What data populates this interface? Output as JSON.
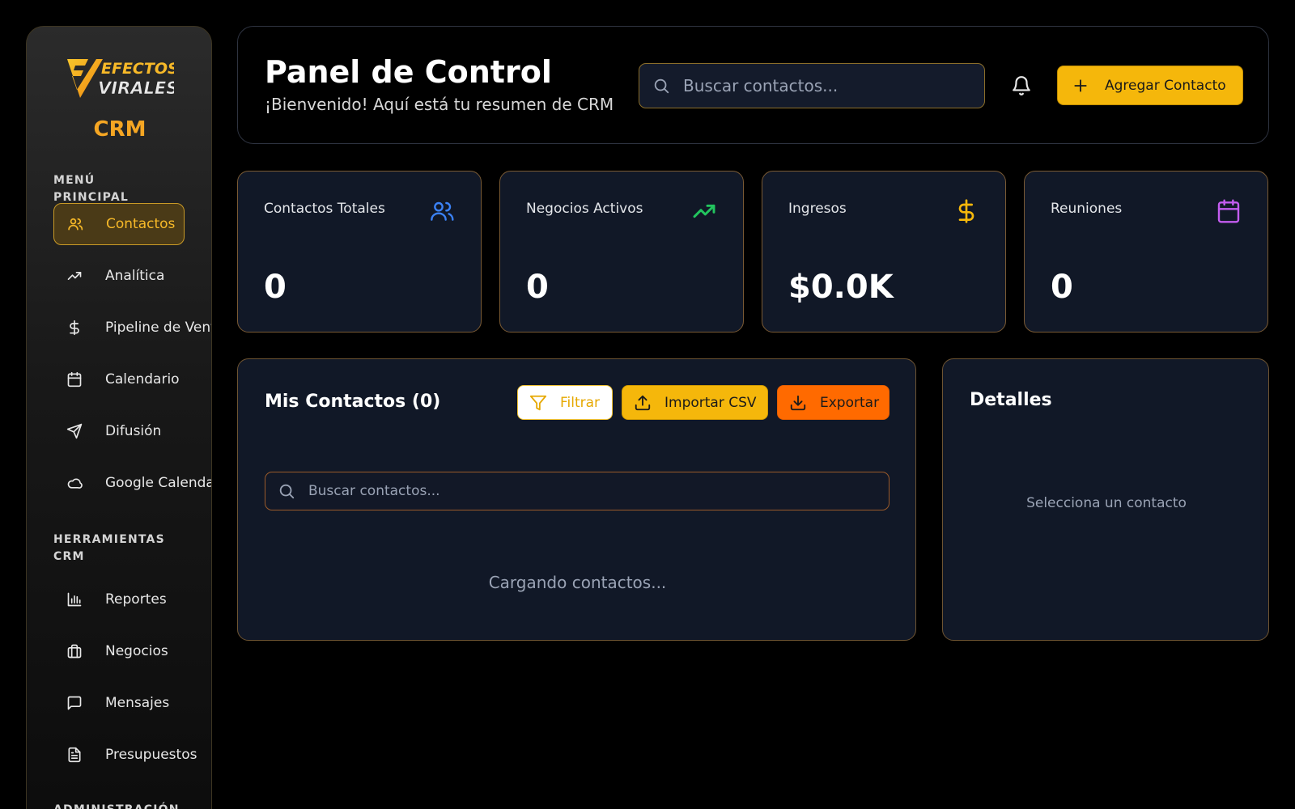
{
  "brand": {
    "logo_text_line1": "EFECTOS",
    "logo_text_line2": "VIRALES",
    "app_name": "CRM"
  },
  "sidebar": {
    "sections": [
      {
        "label": "MENÚ PRINCIPAL"
      },
      {
        "label": "HERRAMIENTAS CRM"
      },
      {
        "label": "ADMINISTRACIÓN"
      }
    ],
    "items": [
      {
        "label": "Contactos",
        "icon": "users-icon",
        "active": true
      },
      {
        "label": "Analítica",
        "icon": "trending-up-icon"
      },
      {
        "label": "Pipeline de Ventas",
        "icon": "dollar-icon"
      },
      {
        "label": "Calendario",
        "icon": "calendar-icon"
      },
      {
        "label": "Difusión",
        "icon": "send-icon"
      },
      {
        "label": "Google Calendar",
        "icon": "cloud-icon"
      },
      {
        "label": "Reportes",
        "icon": "bar-chart-icon"
      },
      {
        "label": "Negocios",
        "icon": "briefcase-icon"
      },
      {
        "label": "Mensajes",
        "icon": "message-icon"
      },
      {
        "label": "Presupuestos",
        "icon": "file-text-icon"
      }
    ]
  },
  "header": {
    "title": "Panel de Control",
    "subtitle": "¡Bienvenido! Aquí está tu resumen de CRM",
    "search_placeholder": "Buscar contactos...",
    "add_button_label": "Agregar Contacto"
  },
  "stats": [
    {
      "label": "Contactos Totales",
      "value": "0",
      "icon": "users-icon",
      "color": "#3b82f6"
    },
    {
      "label": "Negocios Activos",
      "value": "0",
      "icon": "trending-up-icon",
      "color": "#22c55e"
    },
    {
      "label": "Ingresos",
      "value": "$0.0K",
      "icon": "dollar-icon",
      "color": "#f5b70b"
    },
    {
      "label": "Reuniones",
      "value": "0",
      "icon": "calendar-icon",
      "color": "#c45cf0"
    }
  ],
  "contacts": {
    "title": "Mis Contactos (0)",
    "filter_label": "Filtrar",
    "import_label": "Importar CSV",
    "export_label": "Exportar",
    "search_placeholder": "Buscar contactos...",
    "loading_text": "Cargando contactos..."
  },
  "details": {
    "title": "Detalles",
    "empty_text": "Selecciona un contacto"
  },
  "colors": {
    "accent": "#f5b70b",
    "accent_orange": "#ff6a00",
    "card_bg": "#111827"
  }
}
